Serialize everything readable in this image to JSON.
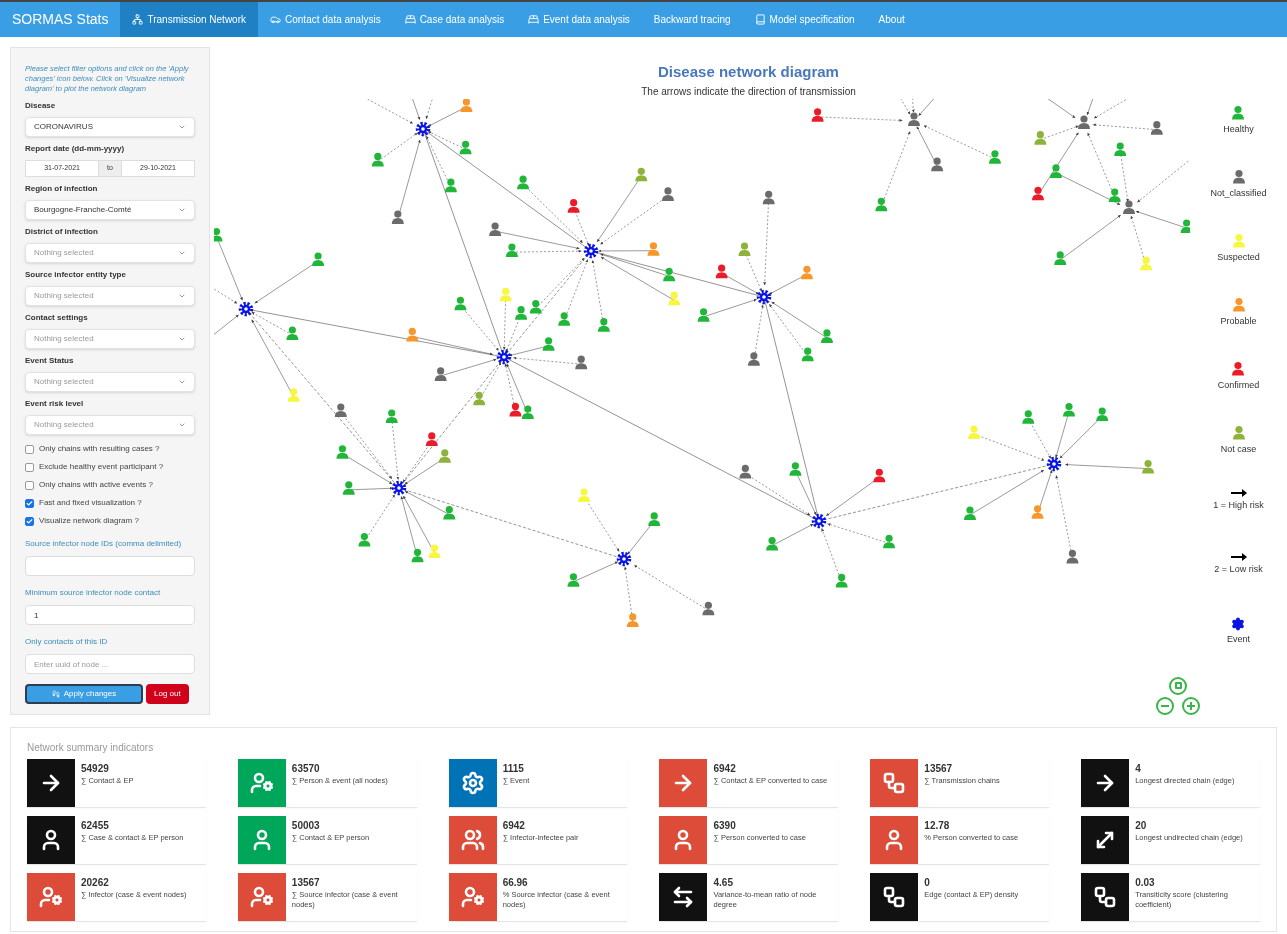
{
  "navbar": {
    "brand": "SORMAS Stats",
    "tabs": [
      {
        "label": "Transmission Network",
        "kind": "network",
        "selected": true
      },
      {
        "label": "Contact data analysis",
        "kind": "car",
        "selected": false
      },
      {
        "label": "Case data analysis",
        "kind": "bed",
        "selected": false
      },
      {
        "label": "Event data analysis",
        "kind": "bed",
        "selected": false
      },
      {
        "label": "Backward tracing",
        "kind": "text",
        "selected": false
      },
      {
        "label": "Model specification",
        "kind": "book",
        "selected": false
      },
      {
        "label": "About",
        "kind": "text",
        "selected": false
      }
    ]
  },
  "sidebar": {
    "intro": "Please select filter options and click on the 'Apply changes' icon below. Click on 'Visualize network diagram' to plot the network diagram",
    "filters": [
      {
        "kind": "select",
        "label": "Disease",
        "value": "CORONAVIRUS"
      },
      {
        "kind": "daterange",
        "label": "Report date (dd-mm-yyyy)",
        "from": "31-07-2021",
        "separator": "to",
        "to": "29-10-2021"
      },
      {
        "kind": "select",
        "label": "Region of infection",
        "value": "Bourgogne-Franche-Comté"
      },
      {
        "kind": "select",
        "label": "District of infection",
        "placeholder": "Nothing selected"
      },
      {
        "kind": "select",
        "label": "Source infector entity type",
        "placeholder": "Nothing selected"
      },
      {
        "kind": "select",
        "label": "Contact settings",
        "placeholder": "Nothing selected"
      },
      {
        "kind": "select",
        "label": "Event Status",
        "placeholder": "Nothing selected"
      },
      {
        "kind": "select",
        "label": "Event risk level",
        "placeholder": "Nothing selected"
      }
    ],
    "checkboxes": [
      {
        "label": "Only chains with resulting cases ?",
        "checked": false
      },
      {
        "label": "Exclude healthy event participant ?",
        "checked": false
      },
      {
        "label": "Only chains with active events ?",
        "checked": false
      },
      {
        "label": "Fast and fixed visualization ?",
        "checked": true
      },
      {
        "label": "Visualize network diagram ?",
        "checked": true
      }
    ],
    "inputs": [
      {
        "label": "Source infector node IDs (comma delimited)"
      },
      {
        "label": "Minimum source infector node contact",
        "value": "1"
      },
      {
        "label": "Only contacts of this ID",
        "placeholder": "Enter uuid of node ..."
      }
    ],
    "buttons": [
      {
        "kind": "apply",
        "label": "Apply changes"
      },
      {
        "kind": "logout",
        "label": "Log out"
      }
    ]
  },
  "diagram": {
    "title": "Disease network diagram",
    "subtitle": "The arrows indicate the direction of transmission",
    "legend": [
      {
        "kind": "person",
        "label": "Healthy",
        "color": "#20b63a"
      },
      {
        "kind": "person",
        "label": "Not_classified",
        "color": "#6b6b6b"
      },
      {
        "kind": "person",
        "label": "Suspected",
        "color": "#f7f740"
      },
      {
        "kind": "person",
        "label": "Probable",
        "color": "#f7962a"
      },
      {
        "kind": "person",
        "label": "Confirmed",
        "color": "#ea1c2a"
      },
      {
        "kind": "person",
        "label": "Not case",
        "color": "#8db33a"
      },
      {
        "kind": "arrow",
        "label": "1 = High risk",
        "color": "#000000"
      },
      {
        "kind": "arrow",
        "label": "2 = Low risk",
        "color": "#000000"
      },
      {
        "kind": "event",
        "label": "Event",
        "color": "#0a14e6"
      }
    ]
  },
  "summary": {
    "title": "Network summary indicators",
    "cards": [
      {
        "value": "54929",
        "label": "∑ Contact & EP",
        "kind": "arrow",
        "color": "#111111"
      },
      {
        "value": "63570",
        "label": "∑ Person & event (all nodes)",
        "kind": "user-gear",
        "color": "#00a65a"
      },
      {
        "value": "1115",
        "label": "∑ Event",
        "kind": "gear",
        "color": "#0073b7"
      },
      {
        "value": "6942",
        "label": "∑ Contact & EP converted to case",
        "kind": "arrow",
        "color": "#dd4b39"
      },
      {
        "value": "13567",
        "label": "∑ Transmission chains",
        "kind": "chain",
        "color": "#dd4b39"
      },
      {
        "value": "4",
        "label": "Longest directed chain (edge)",
        "kind": "arrow",
        "color": "#111111"
      },
      {
        "value": "62455",
        "label": "∑ Case & contact & EP person",
        "kind": "user",
        "color": "#111111"
      },
      {
        "value": "50003",
        "label": "∑ Contact & EP person",
        "kind": "user",
        "color": "#00a65a"
      },
      {
        "value": "6942",
        "label": "∑ Infector-infectee pair",
        "kind": "pair",
        "color": "#dd4b39"
      },
      {
        "value": "6390",
        "label": "∑ Person converted to case",
        "kind": "user",
        "color": "#dd4b39"
      },
      {
        "value": "12.78",
        "label": "% Person converted to case",
        "kind": "user",
        "color": "#dd4b39"
      },
      {
        "value": "20",
        "label": "Longest undirected chain (edge)",
        "kind": "diagonal",
        "color": "#111111"
      },
      {
        "value": "20262",
        "label": "∑ Infector (case & event nodes)",
        "kind": "user-gear",
        "color": "#dd4b39"
      },
      {
        "value": "13567",
        "label": "∑ Source infector (case & event nodes)",
        "kind": "user-gear",
        "color": "#dd4b39"
      },
      {
        "value": "66.96",
        "label": "% Source infector (case & event nodes)",
        "kind": "user-gear",
        "color": "#dd4b39"
      },
      {
        "value": "4.65",
        "label": "Variance-to-mean ratio of node degree",
        "kind": "double-arrow",
        "color": "#111111"
      },
      {
        "value": "0",
        "label": "Edge (contact & EP) density",
        "kind": "chain",
        "color": "#111111"
      },
      {
        "value": "0.03",
        "label": "Transiticity score (clustering coefficient)",
        "kind": "chain",
        "color": "#111111"
      }
    ]
  }
}
